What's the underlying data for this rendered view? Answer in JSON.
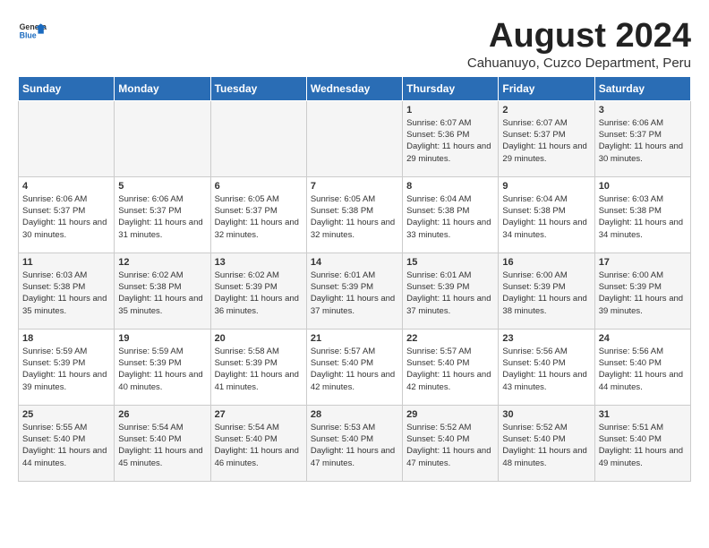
{
  "header": {
    "logo_general": "General",
    "logo_blue": "Blue",
    "main_title": "August 2024",
    "subtitle": "Cahuanuyo, Cuzco Department, Peru"
  },
  "days_of_week": [
    "Sunday",
    "Monday",
    "Tuesday",
    "Wednesday",
    "Thursday",
    "Friday",
    "Saturday"
  ],
  "weeks": [
    [
      {
        "day": "",
        "detail": ""
      },
      {
        "day": "",
        "detail": ""
      },
      {
        "day": "",
        "detail": ""
      },
      {
        "day": "",
        "detail": ""
      },
      {
        "day": "1",
        "detail": "Sunrise: 6:07 AM\nSunset: 5:36 PM\nDaylight: 11 hours\nand 29 minutes."
      },
      {
        "day": "2",
        "detail": "Sunrise: 6:07 AM\nSunset: 5:37 PM\nDaylight: 11 hours\nand 29 minutes."
      },
      {
        "day": "3",
        "detail": "Sunrise: 6:06 AM\nSunset: 5:37 PM\nDaylight: 11 hours\nand 30 minutes."
      }
    ],
    [
      {
        "day": "4",
        "detail": "Sunrise: 6:06 AM\nSunset: 5:37 PM\nDaylight: 11 hours\nand 30 minutes."
      },
      {
        "day": "5",
        "detail": "Sunrise: 6:06 AM\nSunset: 5:37 PM\nDaylight: 11 hours\nand 31 minutes."
      },
      {
        "day": "6",
        "detail": "Sunrise: 6:05 AM\nSunset: 5:37 PM\nDaylight: 11 hours\nand 32 minutes."
      },
      {
        "day": "7",
        "detail": "Sunrise: 6:05 AM\nSunset: 5:38 PM\nDaylight: 11 hours\nand 32 minutes."
      },
      {
        "day": "8",
        "detail": "Sunrise: 6:04 AM\nSunset: 5:38 PM\nDaylight: 11 hours\nand 33 minutes."
      },
      {
        "day": "9",
        "detail": "Sunrise: 6:04 AM\nSunset: 5:38 PM\nDaylight: 11 hours\nand 34 minutes."
      },
      {
        "day": "10",
        "detail": "Sunrise: 6:03 AM\nSunset: 5:38 PM\nDaylight: 11 hours\nand 34 minutes."
      }
    ],
    [
      {
        "day": "11",
        "detail": "Sunrise: 6:03 AM\nSunset: 5:38 PM\nDaylight: 11 hours\nand 35 minutes."
      },
      {
        "day": "12",
        "detail": "Sunrise: 6:02 AM\nSunset: 5:38 PM\nDaylight: 11 hours\nand 35 minutes."
      },
      {
        "day": "13",
        "detail": "Sunrise: 6:02 AM\nSunset: 5:39 PM\nDaylight: 11 hours\nand 36 minutes."
      },
      {
        "day": "14",
        "detail": "Sunrise: 6:01 AM\nSunset: 5:39 PM\nDaylight: 11 hours\nand 37 minutes."
      },
      {
        "day": "15",
        "detail": "Sunrise: 6:01 AM\nSunset: 5:39 PM\nDaylight: 11 hours\nand 37 minutes."
      },
      {
        "day": "16",
        "detail": "Sunrise: 6:00 AM\nSunset: 5:39 PM\nDaylight: 11 hours\nand 38 minutes."
      },
      {
        "day": "17",
        "detail": "Sunrise: 6:00 AM\nSunset: 5:39 PM\nDaylight: 11 hours\nand 39 minutes."
      }
    ],
    [
      {
        "day": "18",
        "detail": "Sunrise: 5:59 AM\nSunset: 5:39 PM\nDaylight: 11 hours\nand 39 minutes."
      },
      {
        "day": "19",
        "detail": "Sunrise: 5:59 AM\nSunset: 5:39 PM\nDaylight: 11 hours\nand 40 minutes."
      },
      {
        "day": "20",
        "detail": "Sunrise: 5:58 AM\nSunset: 5:39 PM\nDaylight: 11 hours\nand 41 minutes."
      },
      {
        "day": "21",
        "detail": "Sunrise: 5:57 AM\nSunset: 5:40 PM\nDaylight: 11 hours\nand 42 minutes."
      },
      {
        "day": "22",
        "detail": "Sunrise: 5:57 AM\nSunset: 5:40 PM\nDaylight: 11 hours\nand 42 minutes."
      },
      {
        "day": "23",
        "detail": "Sunrise: 5:56 AM\nSunset: 5:40 PM\nDaylight: 11 hours\nand 43 minutes."
      },
      {
        "day": "24",
        "detail": "Sunrise: 5:56 AM\nSunset: 5:40 PM\nDaylight: 11 hours\nand 44 minutes."
      }
    ],
    [
      {
        "day": "25",
        "detail": "Sunrise: 5:55 AM\nSunset: 5:40 PM\nDaylight: 11 hours\nand 44 minutes."
      },
      {
        "day": "26",
        "detail": "Sunrise: 5:54 AM\nSunset: 5:40 PM\nDaylight: 11 hours\nand 45 minutes."
      },
      {
        "day": "27",
        "detail": "Sunrise: 5:54 AM\nSunset: 5:40 PM\nDaylight: 11 hours\nand 46 minutes."
      },
      {
        "day": "28",
        "detail": "Sunrise: 5:53 AM\nSunset: 5:40 PM\nDaylight: 11 hours\nand 47 minutes."
      },
      {
        "day": "29",
        "detail": "Sunrise: 5:52 AM\nSunset: 5:40 PM\nDaylight: 11 hours\nand 47 minutes."
      },
      {
        "day": "30",
        "detail": "Sunrise: 5:52 AM\nSunset: 5:40 PM\nDaylight: 11 hours\nand 48 minutes."
      },
      {
        "day": "31",
        "detail": "Sunrise: 5:51 AM\nSunset: 5:40 PM\nDaylight: 11 hours\nand 49 minutes."
      }
    ]
  ]
}
